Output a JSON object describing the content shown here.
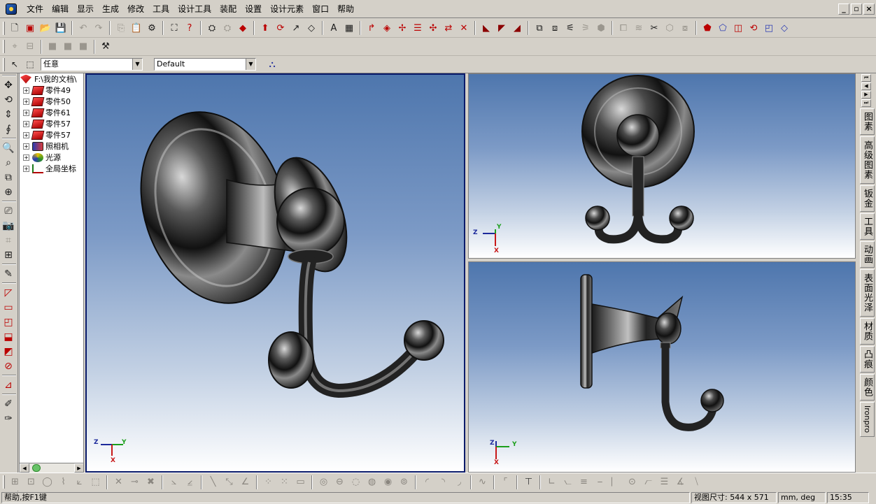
{
  "menu": {
    "items": [
      "文件",
      "编辑",
      "显示",
      "生成",
      "修改",
      "工具",
      "设计工具",
      "装配",
      "设置",
      "设计元素",
      "窗口",
      "帮助"
    ]
  },
  "window_controls": {
    "minimize": "_",
    "restore": "▫",
    "close": "×"
  },
  "toolbar1": {
    "icons": [
      "new-icon",
      "open-icon",
      "folder-icon",
      "save-icon",
      "undo-icon",
      "redo-icon",
      "copy-icon",
      "paste-icon",
      "render-icon",
      "zoom-fit-icon",
      "help-icon",
      "tool-a-icon",
      "tool-b-icon",
      "tool-c-icon",
      "extrude-icon",
      "revolve-icon",
      "sweep-icon",
      "loft-icon",
      "text-icon",
      "image-icon",
      "arrow-tool-icon",
      "shape-1-icon",
      "shape-2-icon",
      "shape-3-icon",
      "shape-4-icon",
      "shape-5-icon",
      "shape-6-icon",
      "material-1-icon",
      "material-2-icon",
      "material-3-icon",
      "edit-1-icon",
      "edit-2-icon",
      "edit-3-icon",
      "edit-4-icon",
      "edit-5-icon",
      "cube-1-icon",
      "cube-2-icon",
      "cube-3-icon",
      "cube-4-icon",
      "cube-5-icon",
      "misc-1-icon",
      "misc-2-icon",
      "misc-3-icon",
      "misc-4-icon",
      "misc-5-icon",
      "misc-6-icon"
    ]
  },
  "toolbar3": {
    "selection_filter": "任意",
    "style_select": "Default"
  },
  "tree": {
    "root": "F:\\我的文档\\",
    "items": [
      {
        "label": "零件49",
        "icon": "part-icon"
      },
      {
        "label": "零件50",
        "icon": "part-icon"
      },
      {
        "label": "零件61",
        "icon": "part-icon"
      },
      {
        "label": "零件57",
        "icon": "part-icon"
      },
      {
        "label": "零件57",
        "icon": "part-icon"
      },
      {
        "label": "照相机",
        "icon": "camera-icon"
      },
      {
        "label": "光源",
        "icon": "light-icon"
      },
      {
        "label": "全局坐标",
        "icon": "coord-icon"
      }
    ]
  },
  "viewports": {
    "main": {
      "triad": {
        "z": "Z",
        "y": "Y",
        "x": "X"
      }
    },
    "top": {
      "triad": {
        "z": "Z",
        "y": "Y",
        "x": "X"
      }
    },
    "bottom": {
      "triad": {
        "z": "Z",
        "y": "Y",
        "x": "X"
      }
    }
  },
  "right_tabs": [
    "图素",
    "高级图素",
    "钣金",
    "工具",
    "动画",
    "表面光泽",
    "材质",
    "凸痕",
    "颜色",
    "Ironpro"
  ],
  "status": {
    "help": "帮助,按F1键",
    "view_size_label": "视图尺寸:",
    "view_size_value": "544 x 571",
    "units": "mm, deg",
    "time": "15:35"
  },
  "colors": {
    "ui_face": "#d4d0c8",
    "viewport_top": "#4e76ad",
    "viewport_bottom": "#ffffff",
    "active_viewport_border": "#0a1b6b",
    "axis_x": "#c81818",
    "axis_y": "#1c9f1c",
    "axis_z": "#1d2a9b"
  }
}
